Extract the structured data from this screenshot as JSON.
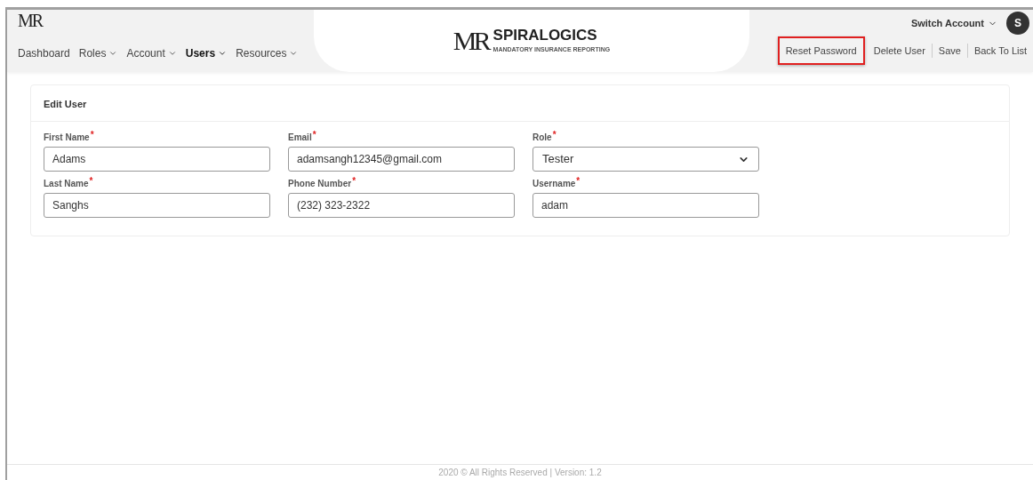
{
  "header": {
    "corner_logo": "MR",
    "brand_mark": "MR",
    "brand_name": "SPIRALOGICS",
    "brand_tagline": "MANDATORY INSURANCE REPORTING",
    "nav": [
      {
        "label": "Dashboard",
        "dropdown": false,
        "selected": false
      },
      {
        "label": "Roles",
        "dropdown": true,
        "selected": false
      },
      {
        "label": "Account",
        "dropdown": true,
        "selected": false
      },
      {
        "label": "Users",
        "dropdown": true,
        "selected": true
      },
      {
        "label": "Resources",
        "dropdown": true,
        "selected": false
      }
    ],
    "account_switcher": "Switch Account",
    "avatar": "S",
    "actions": [
      {
        "label": "Reset Password",
        "highlighted": true
      },
      {
        "label": "Delete User",
        "highlighted": false
      },
      {
        "label": "Save",
        "highlighted": false
      },
      {
        "label": "Back To List",
        "highlighted": false
      }
    ]
  },
  "card": {
    "title": "Edit User",
    "fields": [
      {
        "label": "First Name",
        "required_mark": "*",
        "kind": "text",
        "value": "Adams"
      },
      {
        "label": "Email",
        "required_mark": "*",
        "kind": "text",
        "value": "adamsangh12345@gmail.com"
      },
      {
        "label": "Role",
        "required_mark": "*",
        "kind": "select",
        "value": "Tester"
      },
      {
        "label": "Last Name",
        "required_mark": "*",
        "kind": "text",
        "value": "Sanghs"
      },
      {
        "label": "Phone Number",
        "required_mark": "*",
        "kind": "text",
        "value": "(232) 323-2322"
      },
      {
        "label": "Username",
        "required_mark": "*",
        "kind": "text",
        "value": "adam"
      }
    ]
  },
  "footer": "2020 © All Rights Reserved | Version: 1.2"
}
